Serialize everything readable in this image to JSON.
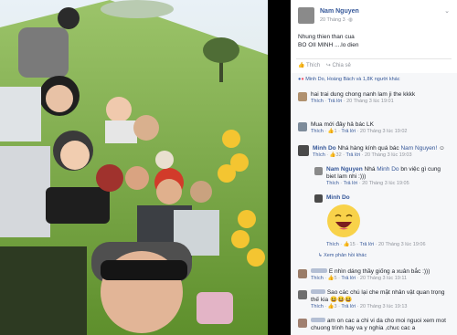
{
  "post": {
    "author": "Nam Nguyen",
    "time": "20 Tháng 3",
    "text_line1": "Nhung thien than cua",
    "text_line2": "BO OII MINH ....lo dien",
    "actions": {
      "like": "Thích",
      "share": "Chia sẻ"
    },
    "reactions_summary": "Minh Do, Hoàng Bách và 1,8K người khác"
  },
  "comments": [
    {
      "author": "",
      "text": "hai trai dung chong nanh lam ji the kkkk",
      "like": "Thích",
      "reply": "Trả lời",
      "time": "20 Tháng 3 lúc 19:01"
    },
    {
      "author": "",
      "text": "Mua mới đây hả bác LK",
      "like": "Thích",
      "reactions": "1",
      "reply": "Trả lời",
      "time": "20 Tháng 3 lúc 19:02"
    },
    {
      "author": "Minh Do",
      "text": "Nhá hàng kính quá bác",
      "mention": "Nam Nguyen!",
      "like": "Thích",
      "reactions": "32",
      "reply": "Trả lời",
      "time": "20 Tháng 3 lúc 19:03"
    }
  ],
  "replies": [
    {
      "author": "Nam Nguyen",
      "text_pre": "Nhá",
      "mention": "Minh Do",
      "text": "bn việc gì cung biet lam nhi :)))",
      "like": "Thích",
      "reply": "Trả lời",
      "time": "20 Tháng 3 lúc 19:05"
    },
    {
      "author": "Minh Do",
      "like": "Thích",
      "reactions": "15",
      "reply": "Trả lời",
      "time": "20 Tháng 3 lúc 19:06"
    }
  ],
  "view_more_replies": "Xem phản hồi khác",
  "comments_after": [
    {
      "text": "E nhìn dáng thầy giống a xuân bắc :)))",
      "like": "Thích",
      "reactions": "5",
      "reply": "Trả lời",
      "time": "20 Tháng 3 lúc 19:11"
    },
    {
      "text": "Sao các chú lại che mặt nhân vật quan trọng thế kia",
      "like": "Thích",
      "reactions": "3",
      "reply": "Trả lời",
      "time": "20 Tháng 3 lúc 19:13"
    },
    {
      "text": "am on cac a chi vi da cho moi nguoi xem mot chuong trinh hay va y nghia ,chuc cac a",
      "like": "",
      "reply": "",
      "time": ""
    }
  ],
  "colors": {
    "link": "#365899",
    "muted": "#90949c",
    "sky": "#cfe3f2",
    "grass": "#6fa43a"
  }
}
